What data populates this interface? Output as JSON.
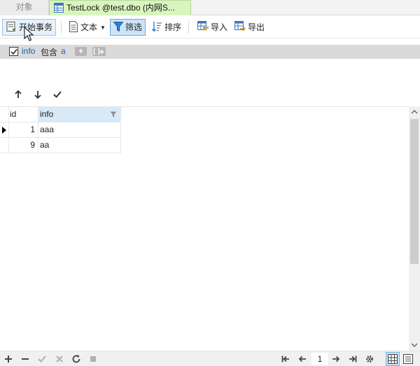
{
  "tabs": {
    "objects_label": "对象",
    "active_label": "TestLock @test.dbo (内网S..."
  },
  "toolbar": {
    "begin_tx_label": "开始事务",
    "text_label": "文本",
    "filter_label": "筛选",
    "sort_label": "排序",
    "import_label": "导入",
    "export_label": "导出"
  },
  "filter": {
    "field": "info",
    "operator": "包含",
    "value": "a"
  },
  "grid": {
    "columns": [
      "id",
      "info"
    ],
    "rows": [
      {
        "id": "1",
        "info": "aaa"
      },
      {
        "id": "9",
        "info": "aa"
      }
    ]
  },
  "pager": {
    "page": "1"
  },
  "colors": {
    "tab_active": "#d9f5bf",
    "filter_bar": "#dadada",
    "header_selected": "#d8e9f8",
    "link_blue": "#1b5fb3"
  }
}
